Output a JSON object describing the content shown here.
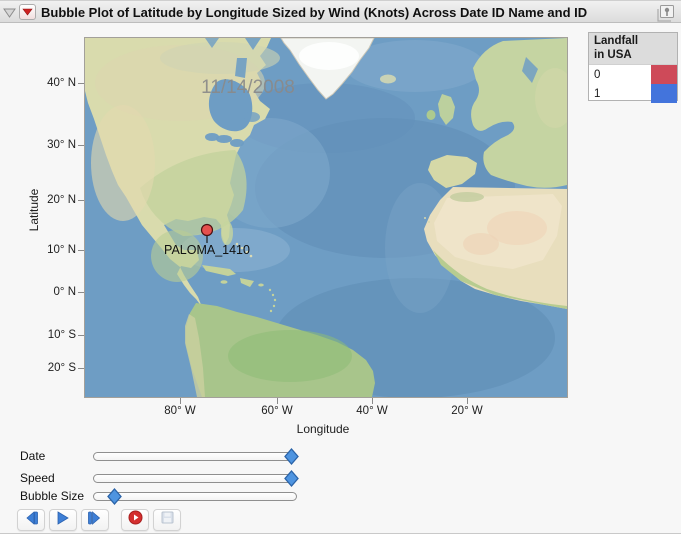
{
  "titlebar": {
    "title": "Bubble Plot of Latitude by Longitude Sized by Wind (Knots) Across Date ID Name and ID"
  },
  "legend": {
    "header_line1": "Landfall",
    "header_line2": "in USA",
    "items": [
      {
        "label": "0",
        "color": "#CE4A59"
      },
      {
        "label": "1",
        "color": "#4374DC"
      }
    ]
  },
  "map": {
    "date_annotation": "11/14/2008",
    "bubble_label": "PALOMA_1410",
    "bubble_color": "#E5504E"
  },
  "axes": {
    "y_label": "Latitude",
    "y_ticks": [
      "40° N",
      "30° N",
      "20° N",
      "10° N",
      "0° N",
      "10° S",
      "20° S"
    ],
    "x_label": "Longitude",
    "x_ticks": [
      "80° W",
      "60° W",
      "40° W",
      "20° W"
    ]
  },
  "sliders": [
    {
      "label": "Date",
      "value_pct": 100
    },
    {
      "label": "Speed",
      "value_pct": 100
    },
    {
      "label": "Bubble Size",
      "value_pct": 8
    }
  ],
  "buttons": [
    {
      "icon": "step-back-icon"
    },
    {
      "icon": "play-icon"
    },
    {
      "icon": "step-forward-icon"
    },
    {
      "icon": "record-icon"
    },
    {
      "icon": "save-icon"
    }
  ]
}
